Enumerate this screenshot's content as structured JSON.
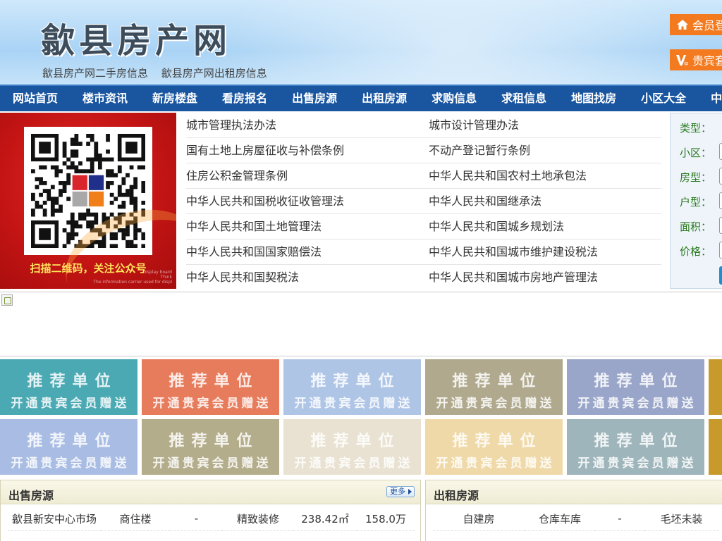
{
  "header": {
    "site_title": "歙县房产网",
    "links": [
      "歙县房产网二手房信息",
      "歙县房产网出租房信息"
    ],
    "login_label": "会员登",
    "vip_label": "贵宾套"
  },
  "nav": {
    "items": [
      "网站首页",
      "楼市资讯",
      "新房楼盘",
      "看房报名",
      "出售房源",
      "出租房源",
      "求购信息",
      "求租信息",
      "地图找房",
      "小区大全",
      "中"
    ]
  },
  "qr_banner": {
    "caption": "扫描二维码，关注公众号",
    "small_text": [
      "Display board",
      "Think",
      "The information carrier used for displ"
    ]
  },
  "laws": [
    "城市管理执法办法",
    "城市设计管理办法",
    "国有土地上房屋征收与补偿条例",
    "不动产登记暂行条例",
    "住房公积金管理条例",
    "中华人民共和国农村土地承包法",
    "中华人民共和国税收征收管理法",
    "中华人民共和国继承法",
    "中华人民共和国土地管理法",
    "中华人民共和国城乡规划法",
    "中华人民共和国国家赔偿法",
    "中华人民共和国城市维护建设税法",
    "中华人民共和国契税法",
    "中华人民共和国城市房地产管理法"
  ],
  "search": {
    "labels": [
      "类型：",
      "小区：",
      "房型：",
      "户型：",
      "面积：",
      "价格："
    ]
  },
  "tiles": {
    "line1": "推荐单位",
    "line2": "开通贵宾会员赠送",
    "colors_row1": [
      "#4aa9b3",
      "#e77c5c",
      "#afc5e6",
      "#b0a98d",
      "#9aa6c9",
      "#c89a2c"
    ],
    "colors_row2": [
      "#a9bde4",
      "#b4ad8b",
      "#e9e2d2",
      "#f0d9a8",
      "#9eb5bb",
      "#c89a2c"
    ]
  },
  "sale": {
    "title": "出售房源",
    "more_label": "更多",
    "rows": [
      [
        "歙县新安中心市场",
        "商住楼",
        "-",
        "精致装修",
        "238.42㎡",
        "158.0万"
      ]
    ]
  },
  "rent": {
    "title": "出租房源",
    "rows": [
      [
        "自建房",
        "仓库车库",
        "-",
        "毛坯未装"
      ]
    ]
  }
}
